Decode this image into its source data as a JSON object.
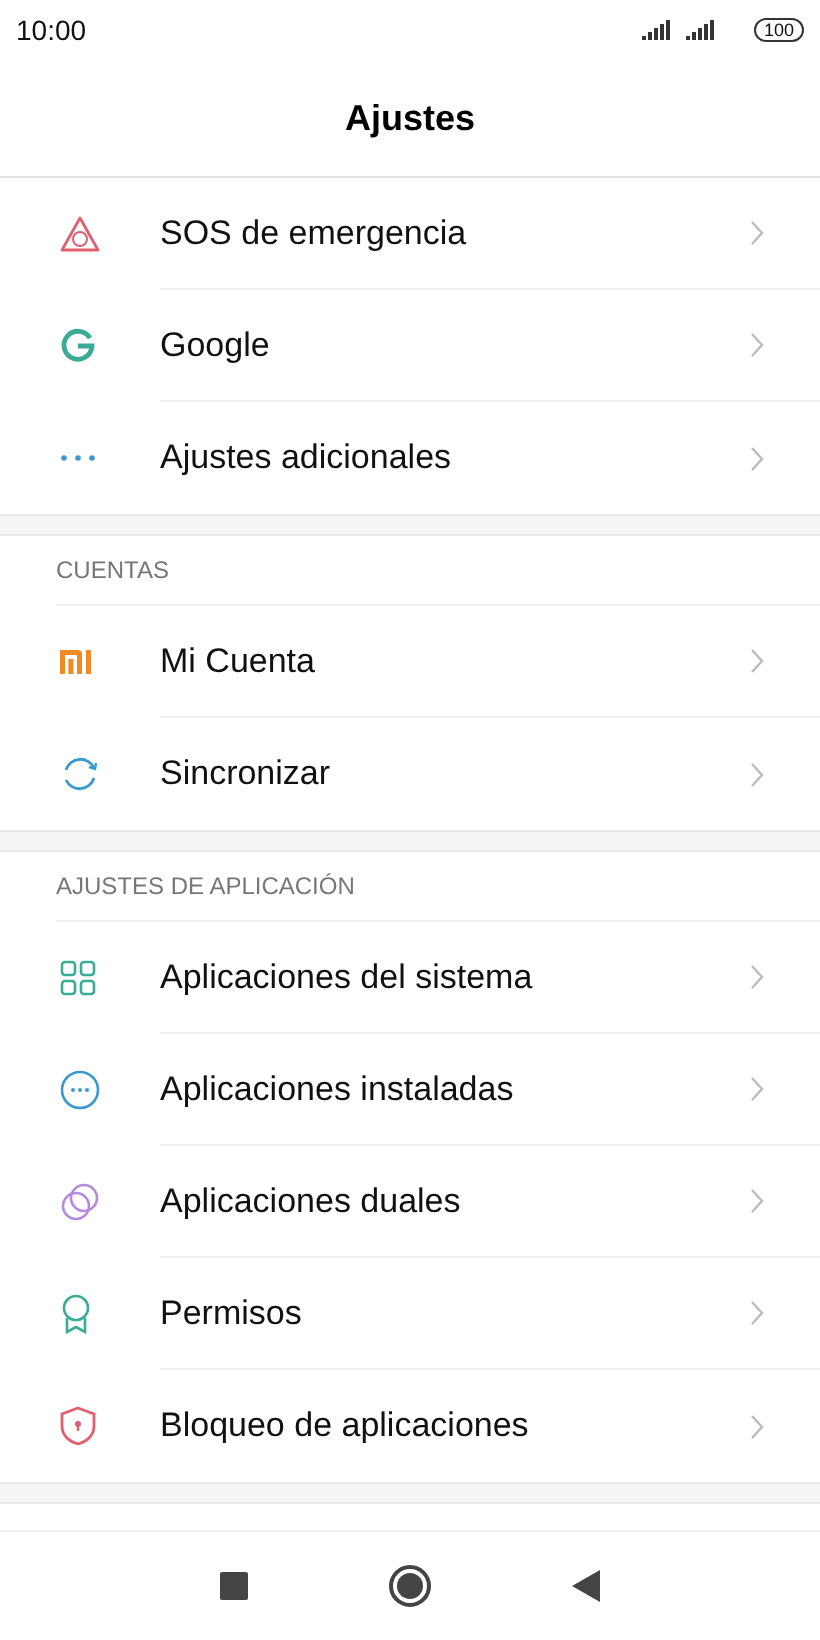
{
  "status_bar": {
    "time": "10:00",
    "battery": "100"
  },
  "title": "Ajustes",
  "sections": [
    {
      "items": [
        {
          "kind": "sos",
          "label": "SOS de emergencia"
        },
        {
          "kind": "google",
          "label": "Google"
        },
        {
          "kind": "dots",
          "label": "Ajustes adicionales"
        }
      ]
    },
    {
      "header": "CUENTAS",
      "items": [
        {
          "kind": "mi",
          "label": "Mi Cuenta"
        },
        {
          "kind": "sync",
          "label": "Sincronizar"
        }
      ]
    },
    {
      "header": "AJUSTES DE APLICACIÓN",
      "items": [
        {
          "kind": "grid",
          "label": "Aplicaciones del sistema"
        },
        {
          "kind": "circle-dots",
          "label": "Aplicaciones instaladas"
        },
        {
          "kind": "rings",
          "label": "Aplicaciones duales"
        },
        {
          "kind": "badge",
          "label": "Permisos"
        },
        {
          "kind": "shield",
          "label": "Bloqueo de aplicaciones"
        }
      ]
    }
  ]
}
